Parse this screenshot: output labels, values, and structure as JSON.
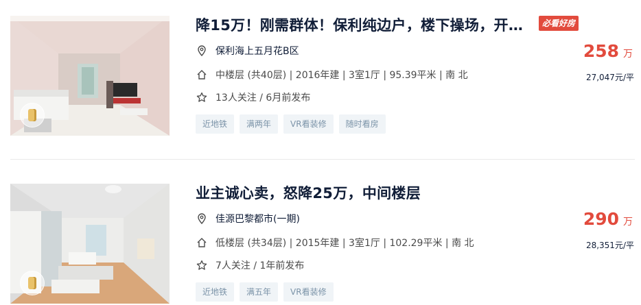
{
  "listings": [
    {
      "title": "降15万！刚需群体！保利纯边户，楼下操场，开…",
      "badge": "必看好房",
      "community": "保利海上五月花B区",
      "info": "中楼层 (共40层) | 2016年建 | 3室1厅 | 95.39平米 | 南 北",
      "follow": "13人关注 / 6月前发布",
      "tags": [
        "近地铁",
        "满两年",
        "VR看装修",
        "随时看房"
      ],
      "price": "258",
      "price_unit": "万",
      "unit_price": "27,047元/平"
    },
    {
      "title": "业主诚心卖，怒降25万，中间楼层",
      "community": "佳源巴黎都市(一期)",
      "info": "低楼层 (共34层) | 2015年建 | 3室1厅 | 102.29平米 | 南 北",
      "follow": "7人关注 / 1年前发布",
      "tags": [
        "近地铁",
        "满五年",
        "VR看装修"
      ],
      "price": "290",
      "price_unit": "万",
      "unit_price": "28,351元/平"
    }
  ],
  "icons": {
    "location": "location-pin-icon",
    "house": "house-icon",
    "star": "star-icon",
    "vr": "vr-cube-icon"
  },
  "colors": {
    "price": "#e24b3d",
    "tag_bg": "#f0f4f7",
    "tag_text": "#7b93a8",
    "title": "#101d37"
  }
}
